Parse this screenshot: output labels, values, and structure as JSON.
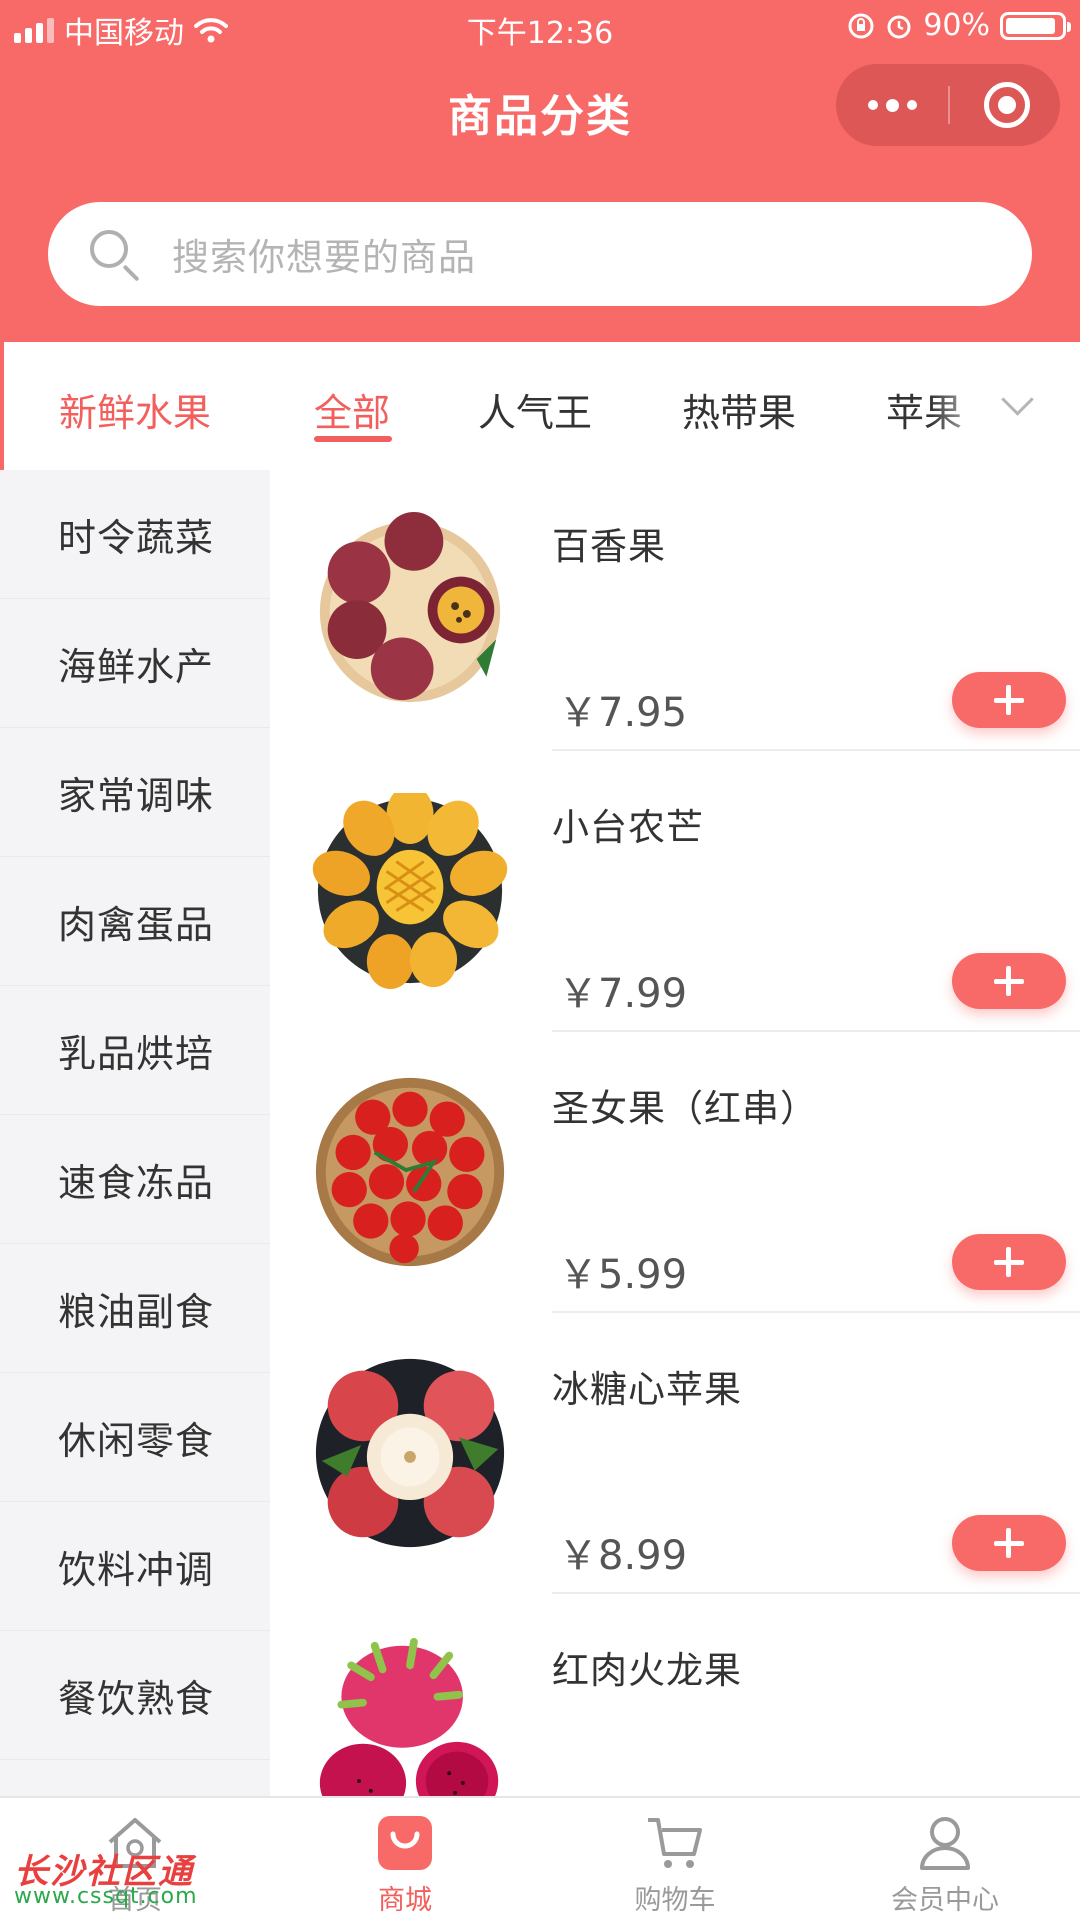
{
  "status_bar": {
    "carrier": "中国移动",
    "time": "下午12:36",
    "battery_text": "90%",
    "battery_level": 0.9
  },
  "header": {
    "title": "商品分类",
    "search_placeholder": "搜索你想要的商品"
  },
  "tabs": {
    "current_category": "新鲜水果",
    "items": [
      "全部",
      "人气王",
      "热带果",
      "苹果"
    ],
    "active_index": 0
  },
  "sidebar": {
    "items": [
      "时令蔬菜",
      "海鲜水产",
      "家常调味",
      "肉禽蛋品",
      "乳品烘培",
      "速食冻品",
      "粮油副食",
      "休闲零食",
      "饮料冲调",
      "餐饮熟食"
    ]
  },
  "products": [
    {
      "name": "百香果",
      "price": "￥7.95"
    },
    {
      "name": "小台农芒",
      "price": "￥7.99"
    },
    {
      "name": "圣女果（红串）",
      "price": "￥5.99"
    },
    {
      "name": "冰糖心苹果",
      "price": "￥8.99"
    },
    {
      "name": "红肉火龙果",
      "price": ""
    }
  ],
  "bottom_nav": {
    "items": [
      {
        "label": "首页",
        "icon": "home-icon"
      },
      {
        "label": "商城",
        "icon": "shopping-bag-icon"
      },
      {
        "label": "购物车",
        "icon": "cart-icon"
      },
      {
        "label": "会员中心",
        "icon": "user-icon"
      }
    ],
    "active_index": 1
  },
  "watermark": {
    "text": "长沙社区通",
    "url": "www.cssqt.com"
  },
  "colors": {
    "accent": "#f86a68",
    "accent_text": "#f2605e",
    "sidebar_bg": "#f4f4f6"
  }
}
